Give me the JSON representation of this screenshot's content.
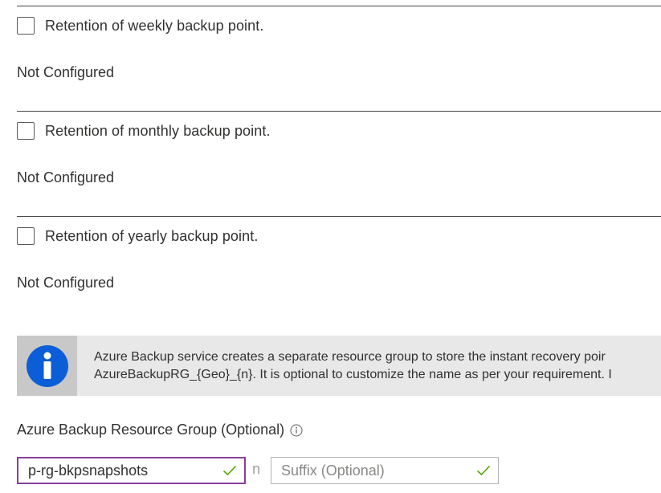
{
  "retention": [
    {
      "label": "Retention of weekly backup point.",
      "checked": false,
      "status": "Not Configured"
    },
    {
      "label": "Retention of monthly backup point.",
      "checked": false,
      "status": "Not Configured"
    },
    {
      "label": "Retention of yearly backup point.",
      "checked": false,
      "status": "Not Configured"
    }
  ],
  "info_banner": {
    "icon": "info-icon",
    "line1": "Azure Backup service creates a separate resource group to store the instant recovery poir",
    "line2": "AzureBackupRG_{Geo}_{n}. It is optional to customize the name as per your requirement. I"
  },
  "resource_group": {
    "label": "Azure Backup Resource Group (Optional)",
    "label_icon": "info-circle-icon",
    "prefix_value": "p-rg-bkpsnapshots",
    "separator": "n",
    "suffix_value": "",
    "suffix_placeholder": "Suffix (Optional)"
  },
  "colors": {
    "active_border": "#8a3d9c",
    "valid_check": "#57a300",
    "info_icon_blue": "#0b5ed7"
  }
}
